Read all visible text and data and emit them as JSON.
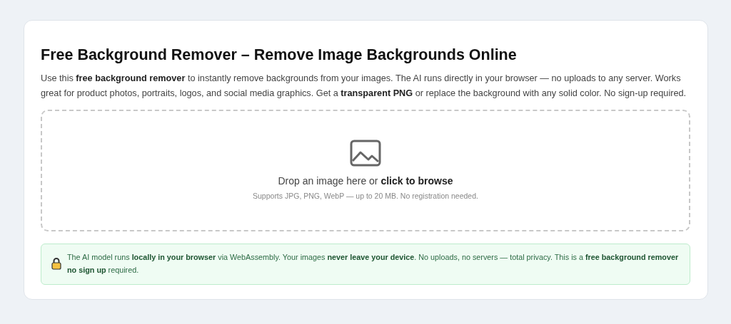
{
  "title": "Free Background Remover – Remove Image Backgrounds Online",
  "intro": "Use this **free background remover** to instantly remove backgrounds from your images. The AI runs directly in your browser — no uploads to any server. Works great for product photos, portraits, logos, and social media graphics. Get a **transparent PNG** or replace the background with any solid color. No sign-up required.",
  "dropzone": {
    "prompt": "Drop an image here or **click to browse**",
    "hint": "Supports JPG, PNG, WebP — up to 20 MB. No registration needed."
  },
  "privacy_note": "The AI model runs **locally in your browser** via WebAssembly. Your images **never leave your device**. No uploads, no servers — total privacy. This is a **free background remover no sign up** required."
}
